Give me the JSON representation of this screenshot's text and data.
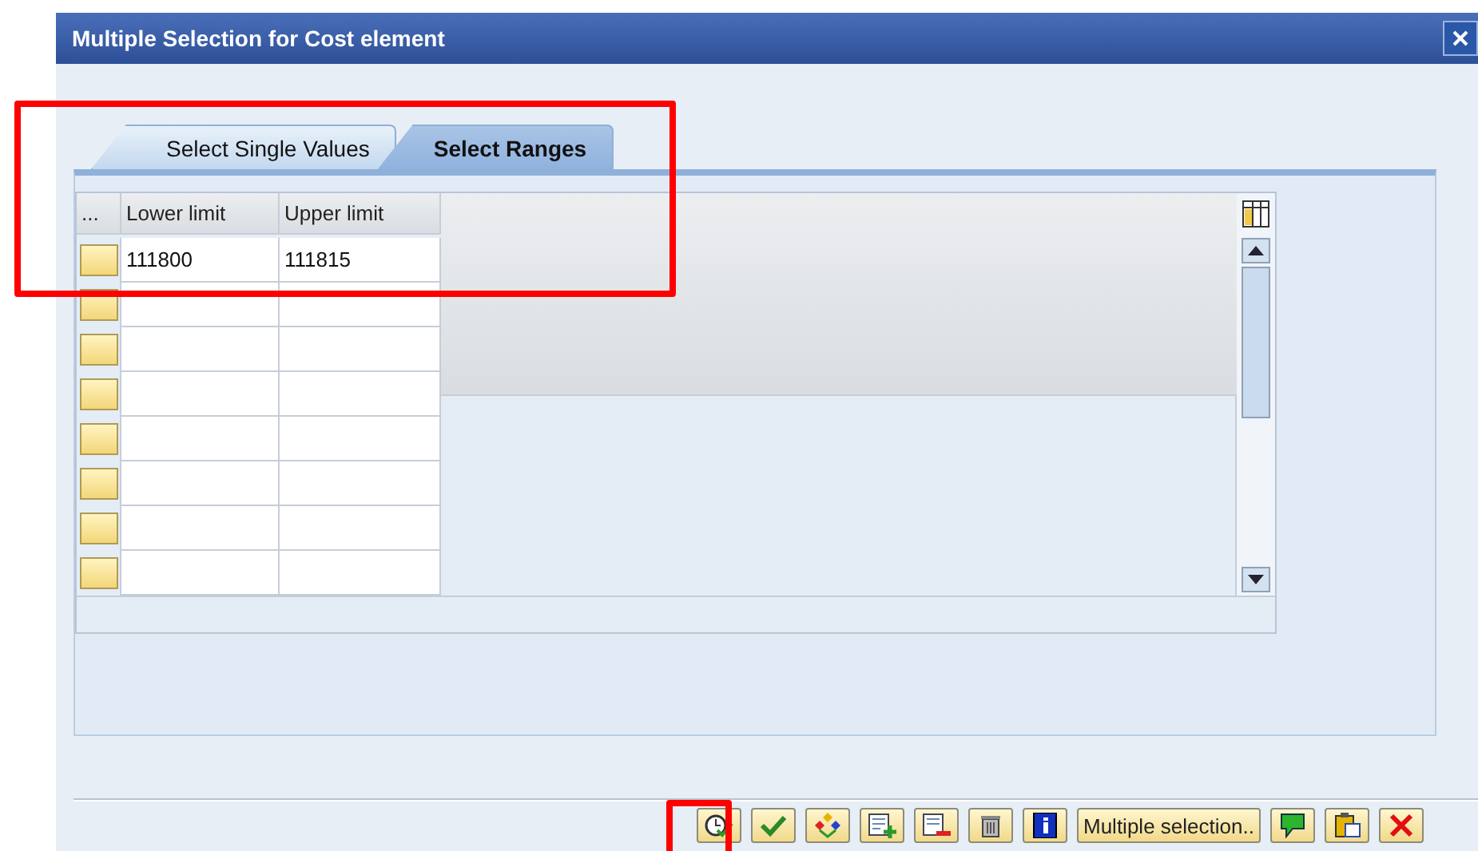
{
  "window": {
    "title": "Multiple Selection for Cost element"
  },
  "tabs": [
    {
      "label": "Select Single Values",
      "selected": false
    },
    {
      "label": "Select Ranges",
      "selected": true
    }
  ],
  "table": {
    "columns": [
      "...",
      "Lower limit",
      "Upper limit"
    ],
    "rows": [
      {
        "lower_limit": "111800",
        "upper_limit": "111815"
      }
    ]
  },
  "toolbar": {
    "text_button": "Multiple selection.."
  }
}
